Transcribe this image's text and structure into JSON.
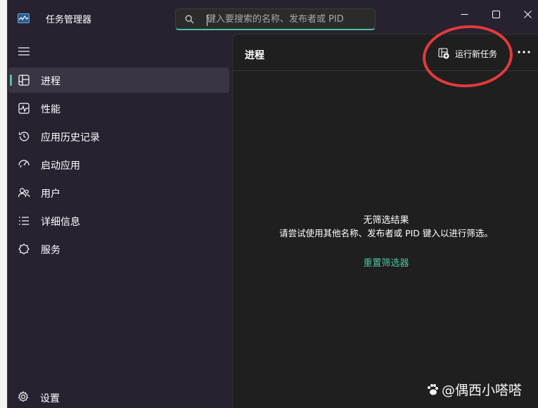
{
  "window": {
    "title": "任务管理器",
    "accent_color": "#4cc2a0",
    "controls": [
      "minimize-icon",
      "maximize-icon",
      "close-icon"
    ]
  },
  "search": {
    "placeholder": "键入要搜索的名称、发布者或 PID",
    "value": ""
  },
  "sidebar": {
    "items": [
      {
        "label": "进程",
        "icon": "processes-icon",
        "active": true
      },
      {
        "label": "性能",
        "icon": "performance-icon",
        "active": false
      },
      {
        "label": "应用历史记录",
        "icon": "app-history-icon",
        "active": false
      },
      {
        "label": "启动应用",
        "icon": "startup-apps-icon",
        "active": false
      },
      {
        "label": "用户",
        "icon": "users-icon",
        "active": false
      },
      {
        "label": "详细信息",
        "icon": "details-icon",
        "active": false
      },
      {
        "label": "服务",
        "icon": "services-icon",
        "active": false
      }
    ],
    "settings_label": "设置"
  },
  "main": {
    "title": "进程",
    "run_task_label": "运行新任务",
    "empty_title": "无筛选结果",
    "empty_desc": "请尝试使用其他名称、发布者或 PID 键入以进行筛选。",
    "reset_label": "重置筛选器"
  },
  "annotation": {
    "color": "#e23a3a"
  },
  "watermark": {
    "text": "@偶西小嗒嗒"
  }
}
